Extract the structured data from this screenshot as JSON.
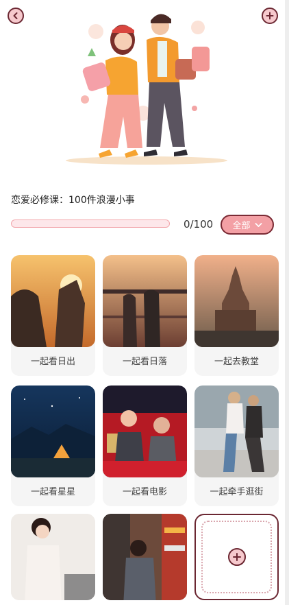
{
  "header": {
    "back_icon": "chevron-left-icon",
    "add_icon": "plus-icon"
  },
  "title": "恋爱必修课：100件浪漫小事",
  "progress": {
    "completed": 0,
    "total": 100,
    "text": "0/100"
  },
  "filter": {
    "selected": "全部",
    "icon": "chevron-down-icon"
  },
  "items": [
    {
      "label": "一起看日出"
    },
    {
      "label": "一起看日落"
    },
    {
      "label": "一起去教堂"
    },
    {
      "label": "一起看星星"
    },
    {
      "label": "一起看电影"
    },
    {
      "label": "一起牵手逛街"
    },
    {
      "label": ""
    },
    {
      "label": ""
    }
  ],
  "add_card": {
    "icon": "plus-icon"
  },
  "colors": {
    "accent_pink": "#f3a0a5",
    "dark_border": "#6b2732",
    "progress_track": "#fde7ea"
  }
}
